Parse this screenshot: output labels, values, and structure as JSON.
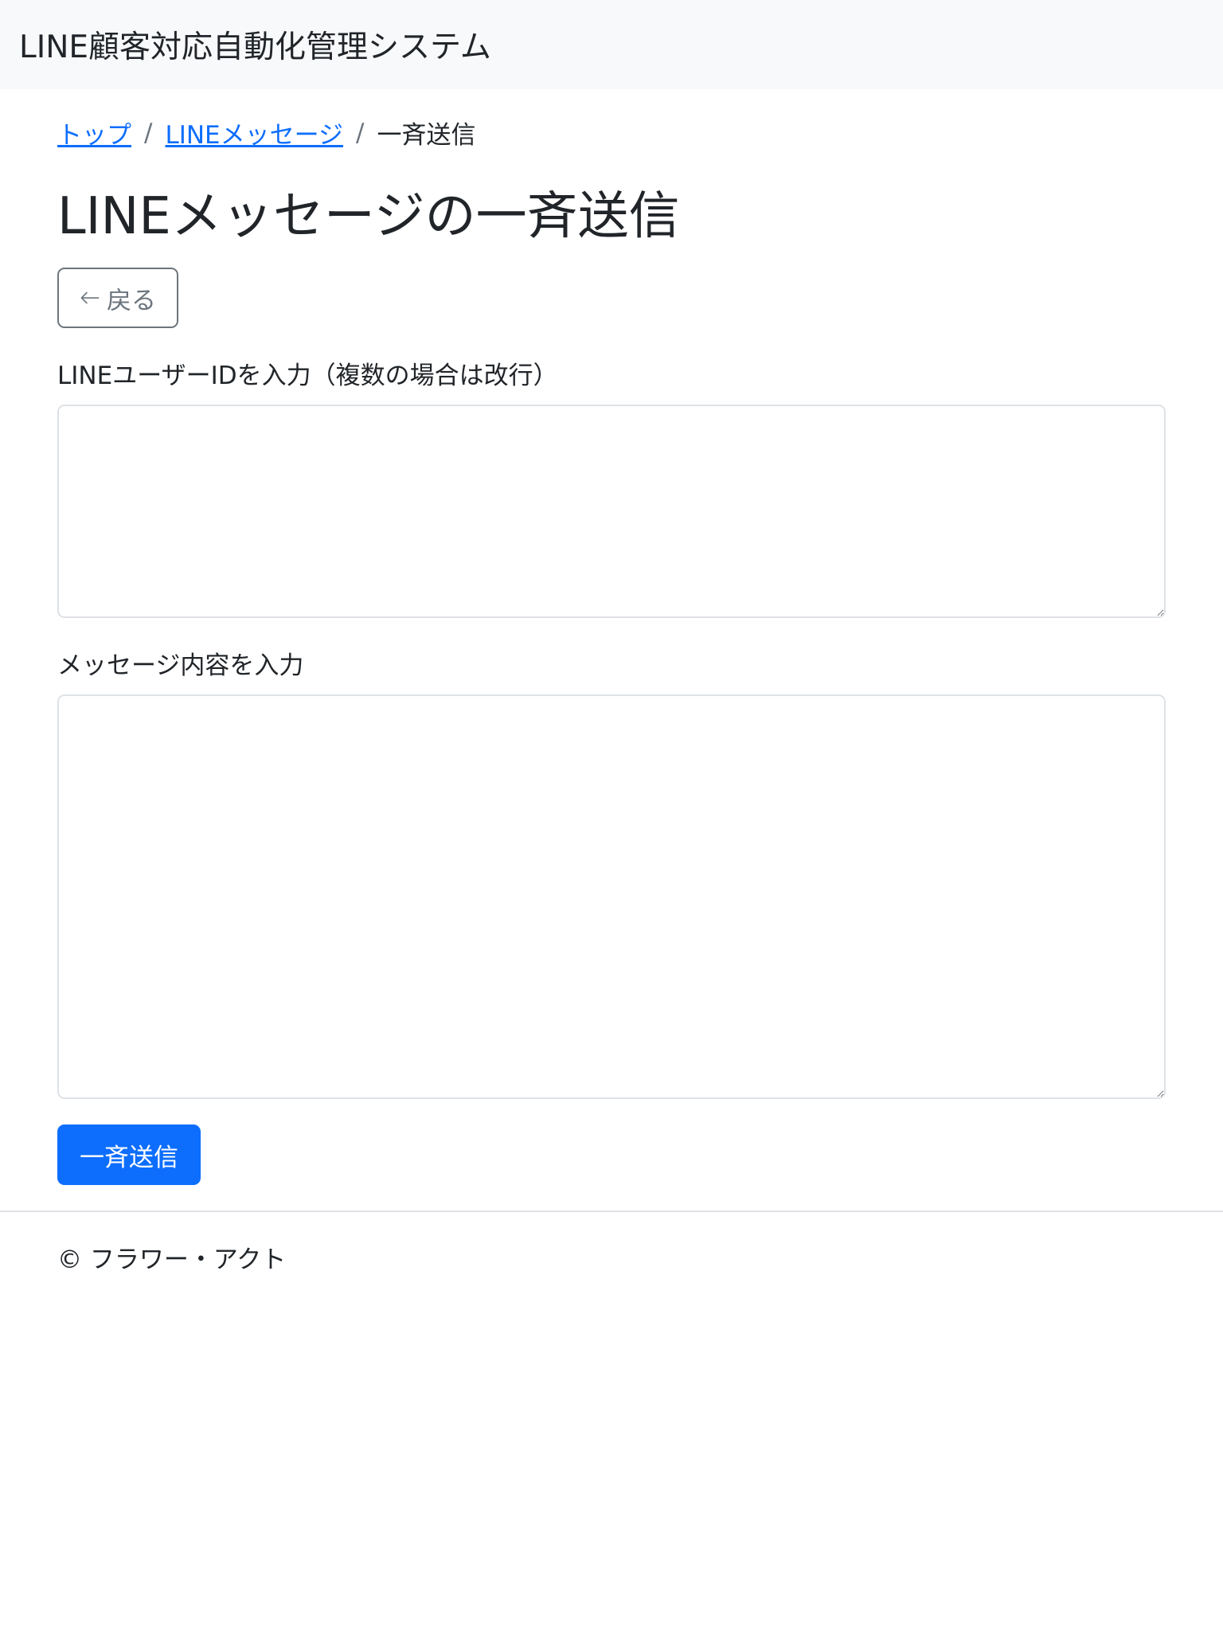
{
  "navbar": {
    "brand": "LINE顧客対応自動化管理システム"
  },
  "breadcrumb": {
    "items": [
      {
        "label": "トップ",
        "link": true
      },
      {
        "label": "LINEメッセージ",
        "link": true
      },
      {
        "label": "一斉送信",
        "link": false
      }
    ],
    "separator": "/"
  },
  "page": {
    "title": "LINEメッセージの一斉送信"
  },
  "back_button": {
    "icon": "arrow-left-icon",
    "label": "戻る"
  },
  "form": {
    "user_ids_label": "LINEユーザーIDを入力（複数の場合は改行）",
    "user_ids_value": "",
    "message_label": "メッセージ内容を入力",
    "message_value": "",
    "submit_label": "一斉送信"
  },
  "footer": {
    "text": "© フラワー・アクト"
  },
  "colors": {
    "primary": "#0d6efd",
    "secondary": "#6c757d",
    "navbar_bg": "#f8f9fa",
    "border": "#dee2e6"
  }
}
